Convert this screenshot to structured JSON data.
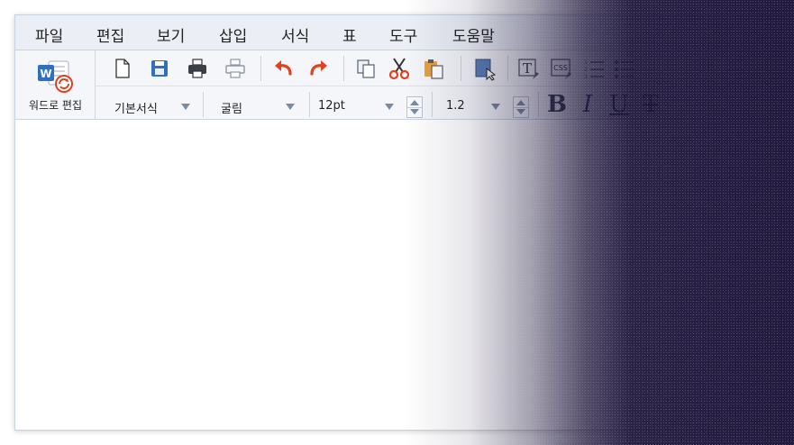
{
  "menubar": {
    "items": [
      "파일",
      "편집",
      "보기",
      "삽입",
      "서식",
      "표",
      "도구",
      "도움말"
    ]
  },
  "word_edit": {
    "label": "워드로 편집",
    "icon": "word-convert-icon",
    "badge": "W"
  },
  "toolbar": {
    "buttons": [
      "new-document",
      "save",
      "print",
      "print-preview",
      "undo",
      "redo",
      "copy",
      "cut",
      "paste",
      "select-object",
      "insert-textbox",
      "css-style",
      "numbered-list",
      "bullet-list"
    ],
    "css_icon_text": "CSS",
    "textbox_icon_text": "T",
    "paragraph_style": "기본서식",
    "font_name": "굴림",
    "font_size": "12pt",
    "line_spacing": "1.2",
    "bold_label": "B",
    "italic_label": "I",
    "underline_label": "U",
    "strike_label": "T"
  },
  "colors": {
    "accent_blue": "#2f6fc0",
    "undo_red": "#e0421e",
    "paste_orange": "#e8a23a",
    "overlay_dark": "#1a1238"
  }
}
